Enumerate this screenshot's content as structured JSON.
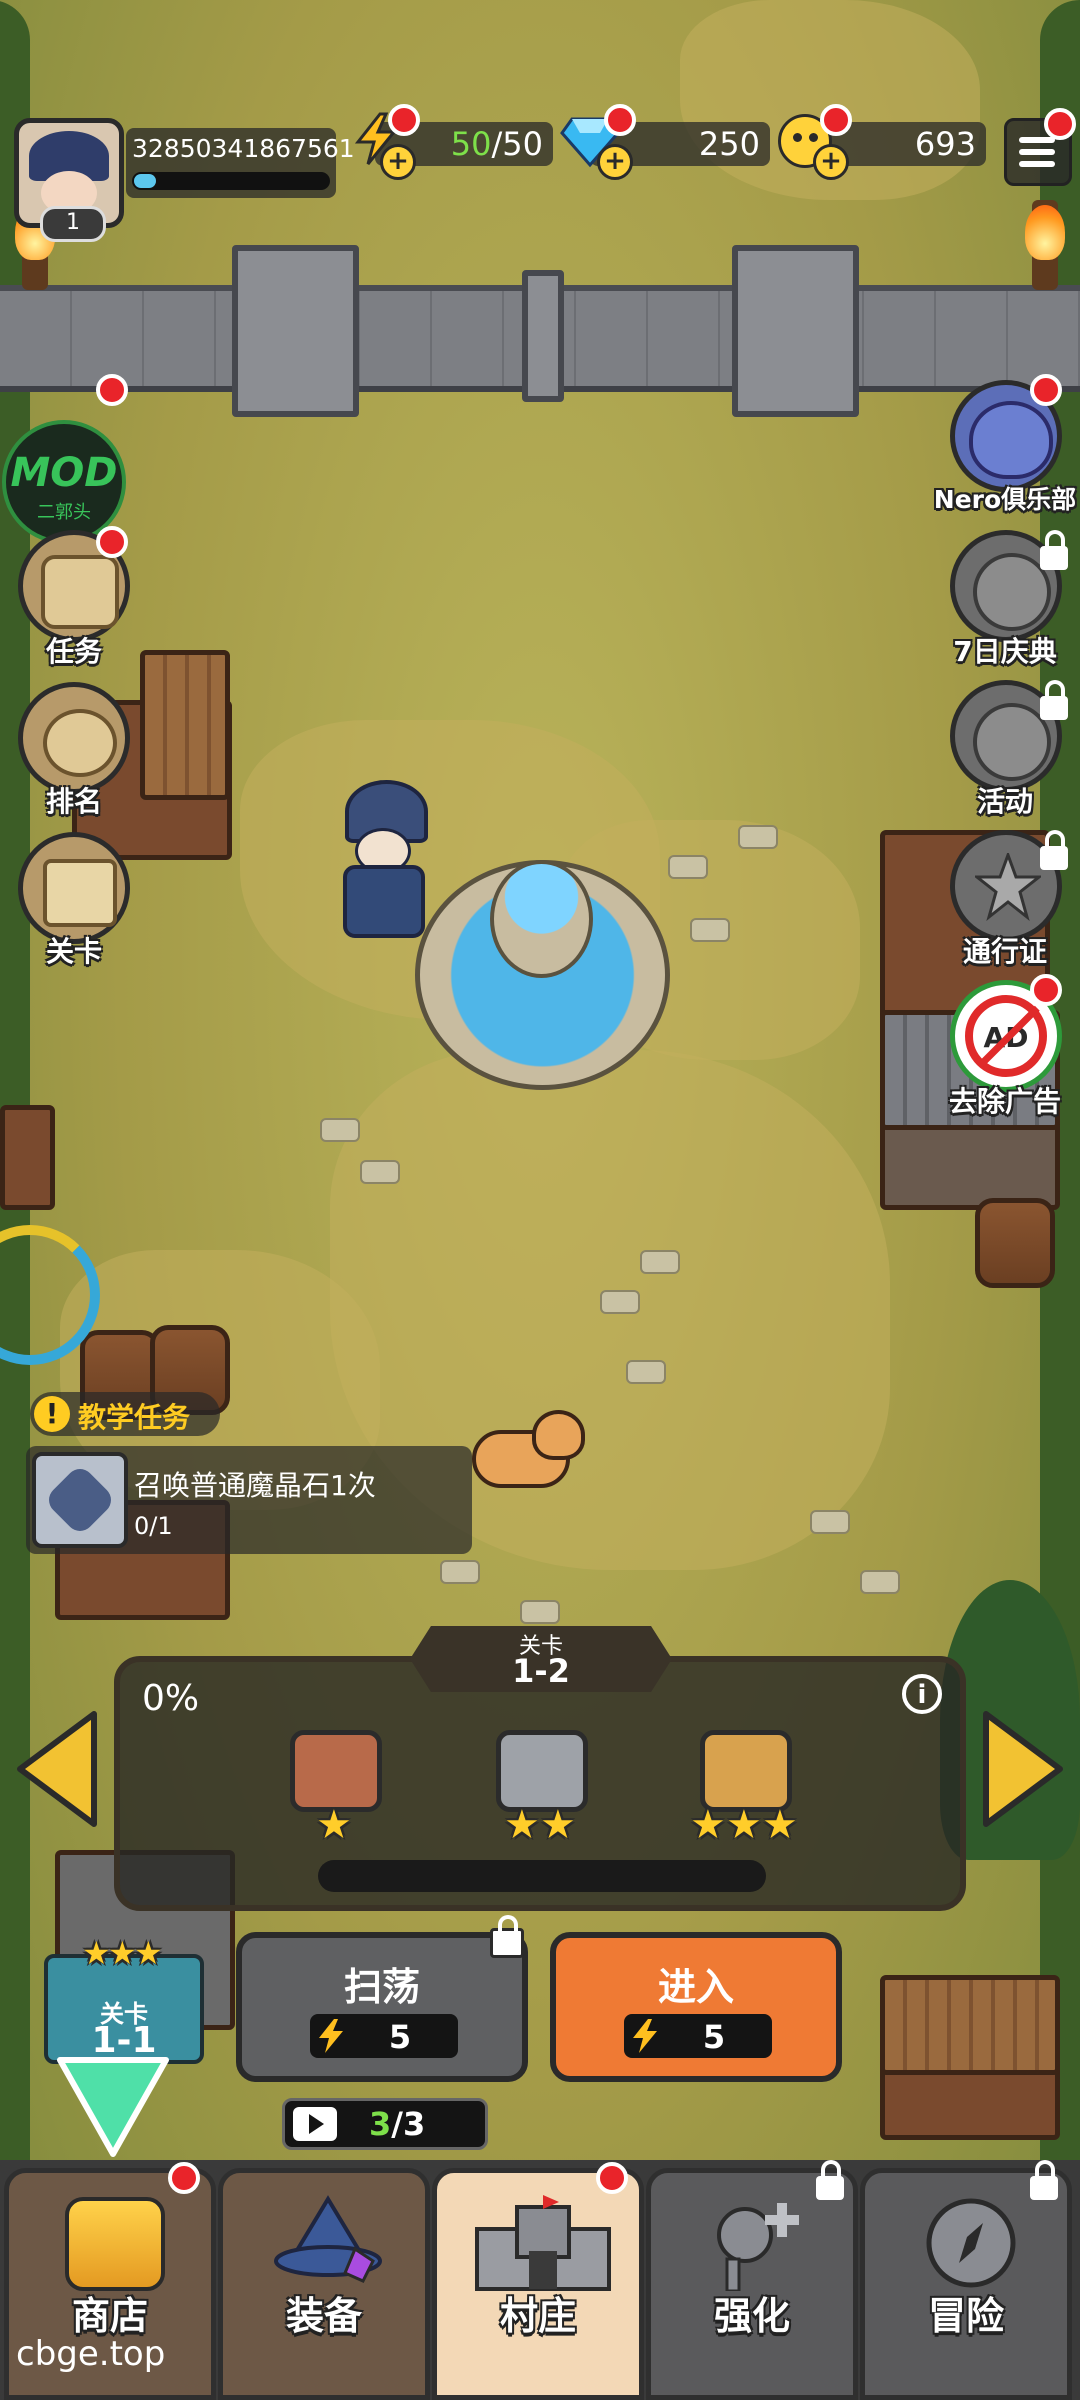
{
  "player": {
    "level": "1",
    "id": "32850341867561"
  },
  "resources": {
    "energy_current": "50",
    "energy_slash_max": "/50",
    "gems": "250",
    "gold": "693"
  },
  "mod_badge": {
    "title": "MOD",
    "subtitle": "二郭头"
  },
  "left_menu": [
    {
      "label": "任务"
    },
    {
      "label": "排名"
    },
    {
      "label": "关卡"
    }
  ],
  "right_menu": [
    {
      "label": "Nero俱乐部"
    },
    {
      "label": "7日庆典"
    },
    {
      "label": "活动"
    },
    {
      "label": "通行证"
    },
    {
      "label": "去除广告",
      "icon_text": "AD"
    }
  ],
  "tutorial": {
    "header": "教学任务",
    "task": "召唤普通魔晶石1次",
    "progress": "0/1"
  },
  "stage_panel": {
    "tag_label": "关卡",
    "stage": "1-2",
    "percent": "0%",
    "progress_fraction": 0,
    "chest_star_counts": [
      1,
      2,
      3
    ]
  },
  "stage_badge": {
    "label": "关卡",
    "stage": "1-1",
    "stars": 3
  },
  "actions": {
    "sweep_label": "扫荡",
    "sweep_cost": "5",
    "enter_label": "进入",
    "enter_cost": "5",
    "ad_count_current": "3",
    "ad_count_max": "/3"
  },
  "bottom_nav": [
    {
      "label": "商店"
    },
    {
      "label": "装备"
    },
    {
      "label": "村庄"
    },
    {
      "label": "强化"
    },
    {
      "label": "冒险"
    }
  ],
  "watermark": "cbge.top",
  "colors": {
    "energy_green": "#7ee04a",
    "enter_orange": "#ef7a34",
    "sweep_gray": "#5f6062",
    "stage_badge_teal": "#3a8fa0",
    "active_tab": "#f3d8b6",
    "tab_brown": "#6d5846",
    "tab_gray": "#5a5a5c"
  }
}
